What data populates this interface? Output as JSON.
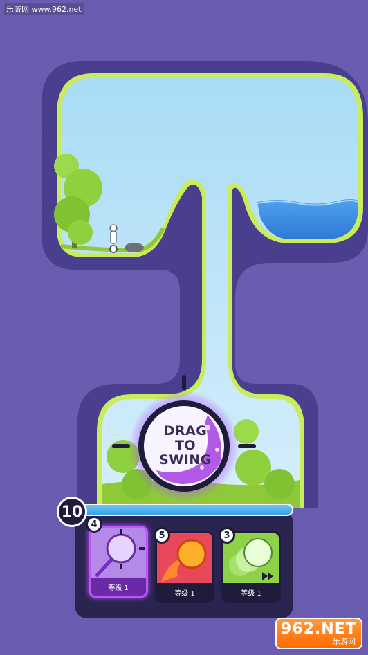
{
  "watermark_top": "乐游网 www.962.net",
  "ball_prompt": [
    "DRAG",
    "TO",
    "SWING"
  ],
  "shots_remaining": "10",
  "power_level": 1.0,
  "cards": [
    {
      "name": "Reticle Ball",
      "count": "4",
      "level_label": "等级 1",
      "selected": true,
      "accent": "#c055ff"
    },
    {
      "name": "Fire Ball",
      "count": "5",
      "level_label": "等级 1",
      "selected": false,
      "accent": "#ff6a2a"
    },
    {
      "name": "Speed Ball",
      "count": "3",
      "level_label": "等级 1",
      "selected": false,
      "accent": "#9be05a"
    }
  ],
  "watermark_bottom": {
    "main": "962.NET",
    "sub": "乐游网"
  },
  "colors": {
    "background": "#6a5cb0",
    "border": "#4a3f8f",
    "sky": "#9fd4f0",
    "grass": "#8fc93a",
    "water": "#3b8be0"
  }
}
